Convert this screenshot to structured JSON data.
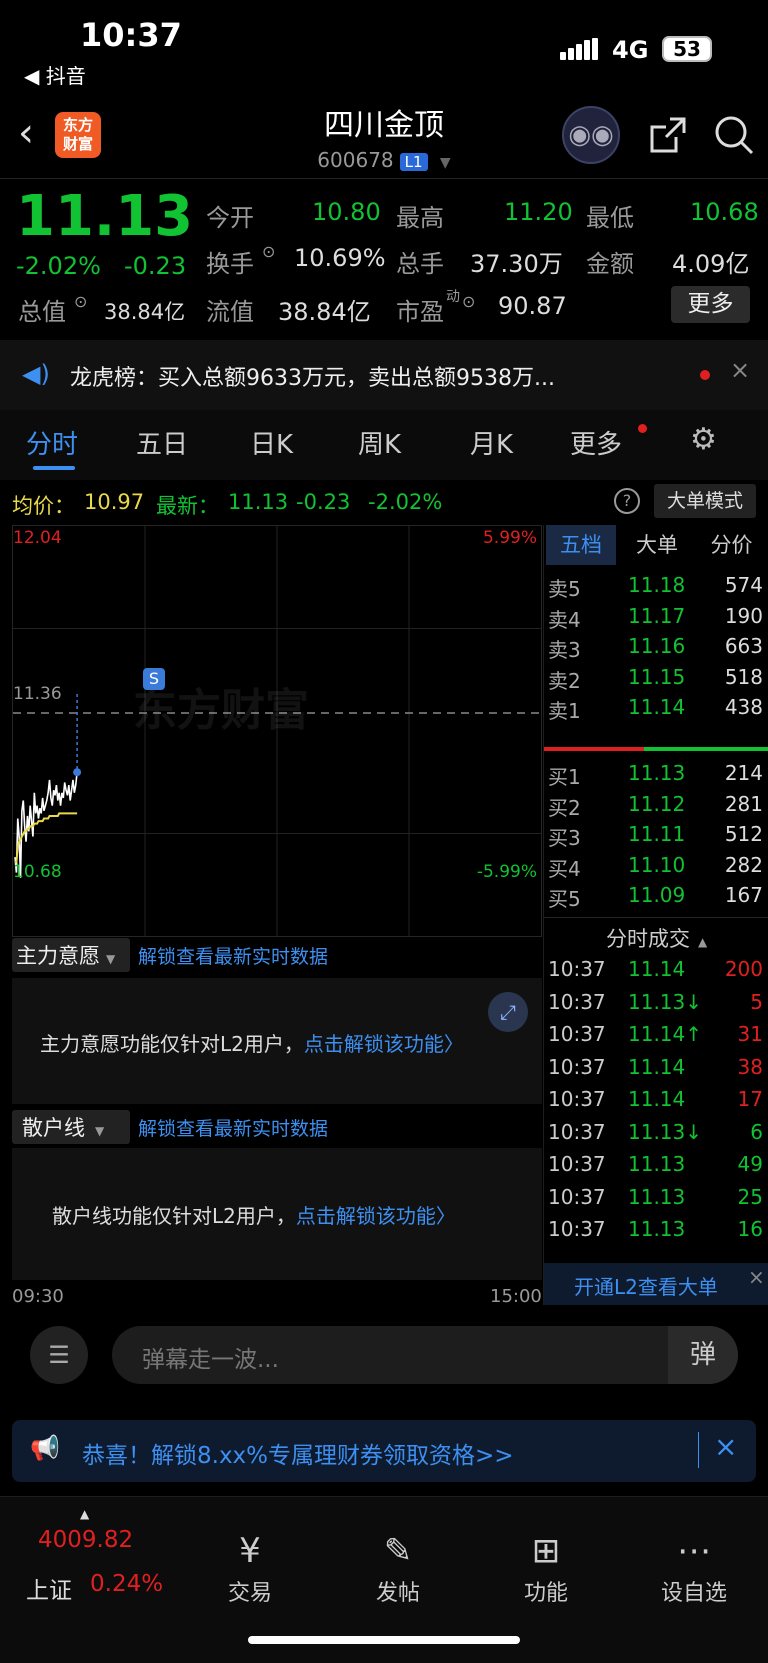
{
  "status": {
    "time": "10:37",
    "back_app": "◀ 抖音",
    "network": "4G",
    "battery": "53"
  },
  "header": {
    "logo_line1": "东方",
    "logo_line2": "财富",
    "title": "四川金顶",
    "code": "600678",
    "level": "L1"
  },
  "quote": {
    "price": "11.13",
    "change_pct": "-2.02%",
    "change": "-0.23",
    "total_value_label": "总值",
    "total_value": "38.84亿",
    "open_label": "今开",
    "open": "10.80",
    "high_label": "最高",
    "high": "11.20",
    "low_label": "最低",
    "low": "10.68",
    "turnover_label": "换手",
    "turnover": "10.69%",
    "volume_label": "总手",
    "volume": "37.30万",
    "amount_label": "金额",
    "amount": "4.09亿",
    "float_label": "流值",
    "float_value": "38.84亿",
    "pe_label": "市盈",
    "pe_sup": "动",
    "pe": "90.87",
    "more": "更多"
  },
  "notice": {
    "text": "龙虎榜：买入总额9633万元，卖出总额9538万..."
  },
  "tabs": [
    "分时",
    "五日",
    "日K",
    "周K",
    "月K",
    "更多"
  ],
  "avgbar": {
    "avg_label": "均价：",
    "avg": "10.97",
    "latest_label": "最新：",
    "latest": "11.13",
    "chg": "-0.23",
    "pct": "-2.02%",
    "mode": "大单模式"
  },
  "chart_data": {
    "type": "line",
    "title": "",
    "y_top": "12.04",
    "y_mid": "11.36",
    "y_bottom": "10.68",
    "pct_top": "5.99%",
    "pct_bottom": "-5.99%",
    "x_start": "09:30",
    "x_end": "15:00",
    "ylim": [
      10.68,
      12.04
    ],
    "series": [
      {
        "name": "price",
        "color": "#ffffff",
        "values": [
          10.8,
          10.74,
          10.95,
          10.88,
          10.72,
          10.98,
          11.02,
          10.92,
          10.86,
          10.96,
          10.9,
          11.0,
          10.94,
          10.88,
          11.05,
          10.97,
          11.0,
          10.95,
          10.99,
          10.97,
          11.03,
          10.98,
          11.0,
          11.02,
          11.05,
          11.1,
          11.03,
          11.0,
          11.06,
          11.04,
          11.08,
          11.02,
          11.05,
          11.0,
          11.05,
          11.03,
          11.09,
          11.06,
          11.04,
          11.08,
          11.02,
          11.06,
          11.1,
          11.05,
          11.08,
          11.13
        ]
      },
      {
        "name": "avg",
        "color": "#e8d84a",
        "values": [
          10.78,
          10.78,
          10.84,
          10.86,
          10.87,
          10.88,
          10.89,
          10.9,
          10.9,
          10.91,
          10.91,
          10.92,
          10.92,
          10.92,
          10.93,
          10.93,
          10.93,
          10.94,
          10.94,
          10.94,
          10.94,
          10.95,
          10.95,
          10.95,
          10.95,
          10.96,
          10.96,
          10.96,
          10.96,
          10.96,
          10.96,
          10.96,
          10.97,
          10.97,
          10.97,
          10.97,
          10.97,
          10.97,
          10.97,
          10.97,
          10.97,
          10.97,
          10.97,
          10.97,
          10.97,
          10.97
        ]
      }
    ],
    "watermark": "东方财富",
    "marker": "S"
  },
  "orderbook": {
    "tabs": [
      "五档",
      "大单",
      "分价"
    ],
    "sells": [
      {
        "label": "卖5",
        "price": "11.18",
        "vol": "574"
      },
      {
        "label": "卖4",
        "price": "11.17",
        "vol": "190"
      },
      {
        "label": "卖3",
        "price": "11.16",
        "vol": "663"
      },
      {
        "label": "卖2",
        "price": "11.15",
        "vol": "518"
      },
      {
        "label": "卖1",
        "price": "11.14",
        "vol": "438"
      }
    ],
    "buys": [
      {
        "label": "买1",
        "price": "11.13",
        "vol": "214"
      },
      {
        "label": "买2",
        "price": "11.12",
        "vol": "281"
      },
      {
        "label": "买3",
        "price": "11.11",
        "vol": "512"
      },
      {
        "label": "买4",
        "price": "11.10",
        "vol": "282"
      },
      {
        "label": "买5",
        "price": "11.09",
        "vol": "167"
      }
    ],
    "ticks_title": "分时成交",
    "ticks": [
      {
        "t": "10:37",
        "p": "11.14",
        "v": "200",
        "dir": "",
        "vc": "red"
      },
      {
        "t": "10:37",
        "p": "11.13↓",
        "v": "5",
        "dir": "down",
        "vc": "red"
      },
      {
        "t": "10:37",
        "p": "11.14↑",
        "v": "31",
        "dir": "up",
        "vc": "red"
      },
      {
        "t": "10:37",
        "p": "11.14",
        "v": "38",
        "dir": "",
        "vc": "red"
      },
      {
        "t": "10:37",
        "p": "11.14",
        "v": "17",
        "dir": "",
        "vc": "red"
      },
      {
        "t": "10:37",
        "p": "11.13↓",
        "v": "6",
        "dir": "down",
        "vc": "green"
      },
      {
        "t": "10:37",
        "p": "11.13",
        "v": "49",
        "dir": "",
        "vc": "green"
      },
      {
        "t": "10:37",
        "p": "11.13",
        "v": "25",
        "dir": "",
        "vc": "green"
      },
      {
        "t": "10:37",
        "p": "11.13",
        "v": "16",
        "dir": "",
        "vc": "green"
      }
    ],
    "l2_button": "开通L2查看大单"
  },
  "panels": {
    "p1_title": "主力意愿",
    "p1_link": "解锁查看最新实时数据",
    "p1_text": "主力意愿功能仅针对L2用户，",
    "p1_cta": "点击解锁该功能〉",
    "p2_title": "散户线",
    "p2_link": "解锁查看最新实时数据",
    "p2_text": "散户线功能仅针对L2用户，",
    "p2_cta": "点击解锁该功能〉"
  },
  "comment": {
    "placeholder": "弹幕走一波...",
    "danmu_icon": "弹"
  },
  "promo": {
    "text": "恭喜！解锁8.xx%专属理财券领取资格>>"
  },
  "nav": {
    "index_value": "4009.82",
    "index_name": "上证",
    "index_pct": "0.24%",
    "items": [
      "交易",
      "发帖",
      "功能",
      "设自选"
    ]
  }
}
